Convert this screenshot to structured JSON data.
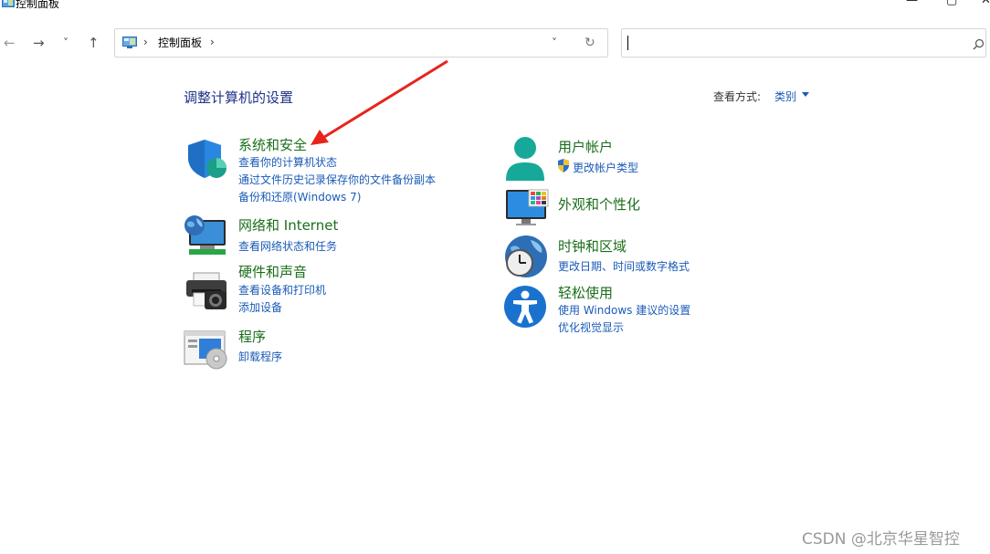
{
  "window": {
    "title": "控制面板",
    "minimize_glyph": "—",
    "maximize_glyph": "▢",
    "close_glyph": "✕"
  },
  "nav": {
    "back": "←",
    "forward": "→",
    "recent": "˅",
    "up": "↑",
    "breadcrumb_sep1": "›",
    "breadcrumb_item": "控制面板",
    "breadcrumb_sep2": "›",
    "dropdown": "˅",
    "refresh": "↻"
  },
  "search": {
    "value": "",
    "icon": "search-icon"
  },
  "header": {
    "title": "调整计算机的设置",
    "view_by_label": "查看方式:",
    "view_by_value": "类别"
  },
  "categories": [
    {
      "title": "系统和安全",
      "icon": "shield-icon",
      "links": [
        "查看你的计算机状态",
        "通过文件历史记录保存你的文件备份副本",
        "备份和还原(Windows 7)"
      ]
    },
    {
      "title": "网络和 Internet",
      "icon": "network-icon",
      "links": [
        "查看网络状态和任务"
      ]
    },
    {
      "title": "硬件和声音",
      "icon": "printer-icon",
      "links": [
        "查看设备和打印机",
        "添加设备"
      ]
    },
    {
      "title": "程序",
      "icon": "programs-icon",
      "links": [
        "卸载程序"
      ]
    },
    {
      "title": "用户帐户",
      "icon": "user-icon",
      "links": [
        "更改帐户类型"
      ]
    },
    {
      "title": "外观和个性化",
      "icon": "monitor-icon",
      "links": []
    },
    {
      "title": "时钟和区域",
      "icon": "clock-globe-icon",
      "links": [
        "更改日期、时间或数字格式"
      ]
    },
    {
      "title": "轻松使用",
      "icon": "accessibility-icon",
      "links": [
        "使用 Windows 建议的设置",
        "优化视觉显示"
      ]
    }
  ],
  "watermark": "CSDN @北京华星智控",
  "colors": {
    "category_title": "#1a6e1a",
    "link": "#1a5bb7",
    "page_title": "#1e3287",
    "annotation_arrow": "#e8231d"
  }
}
